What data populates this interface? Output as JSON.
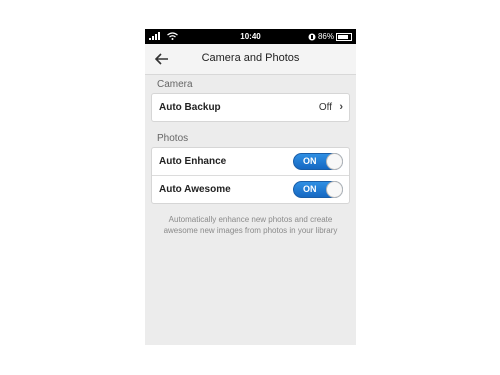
{
  "status_bar": {
    "time": "10:40",
    "battery": "86%",
    "battery_level": 0.86
  },
  "header": {
    "title": "Camera and Photos",
    "back_icon": "arrow-left-icon"
  },
  "camera_section": {
    "header": "Camera",
    "auto_backup": {
      "label": "Auto Backup",
      "value": "Off",
      "chevron": "›"
    }
  },
  "photos_section": {
    "header": "Photos",
    "auto_enhance": {
      "label": "Auto Enhance",
      "toggle": "ON"
    },
    "auto_awesome": {
      "label": "Auto Awesome",
      "toggle": "ON"
    },
    "footnote": "Automatically enhance new photos and create awesome new images from photos in your library"
  },
  "colors": {
    "toggle_on": "#1f7bd6",
    "background": "#ececec",
    "status_bar": "#000000"
  }
}
